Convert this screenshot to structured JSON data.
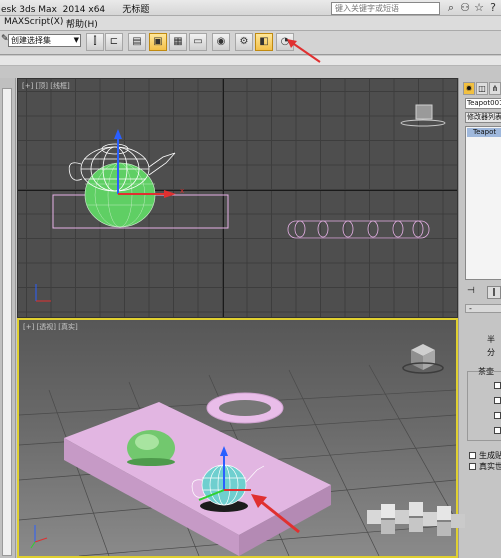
{
  "titlebar": {
    "app_title": "esk 3ds Max  2014 x64",
    "doc_title": "无标题",
    "search_placeholder": "键入关键字或短语",
    "icons": [
      "binoculars-icon",
      "user-icon",
      "star-icon",
      "help-icon"
    ]
  },
  "menubar": {
    "items": [
      "MAXScript(X)",
      "帮助(H)"
    ]
  },
  "toolbar": {
    "selection_set": "创建选择集",
    "tools": [
      "mirror-icon",
      "align-icon",
      "toggle-scene-explorer-icon",
      "toggle-layer-explorer-icon",
      "graphite-modeling-icon",
      "curve-editor-icon",
      "schematic-view-icon",
      "material-editor-icon",
      "render-setup-icon",
      "rendered-frame-window-icon",
      "render-production-icon"
    ]
  },
  "viewport_top": {
    "label": "[+] [顶] [线框]"
  },
  "viewport_persp": {
    "label": "[+] [透视] [真实]"
  },
  "command_panel": {
    "tabs": [
      "create-tab-icon",
      "modify-tab-icon",
      "hierarchy-tab-icon"
    ],
    "object_name": "Teapot001",
    "modifier_list": "修改器列表",
    "stack_item": "Teapot",
    "rollout_marker": "-",
    "param_radius": "半",
    "param_segments": "分",
    "group_label": "茶壶",
    "gen_mapping": "生成贴",
    "real_world": "真实世"
  },
  "colors": {
    "viewport_top_bg": "#4e4e4e",
    "active_border": "#e0d030",
    "box_pink": "#d9a8d8",
    "hemisphere_green": "#7ed47a",
    "teapot_wire": "#ffffff",
    "arrow_red": "#e03030"
  }
}
